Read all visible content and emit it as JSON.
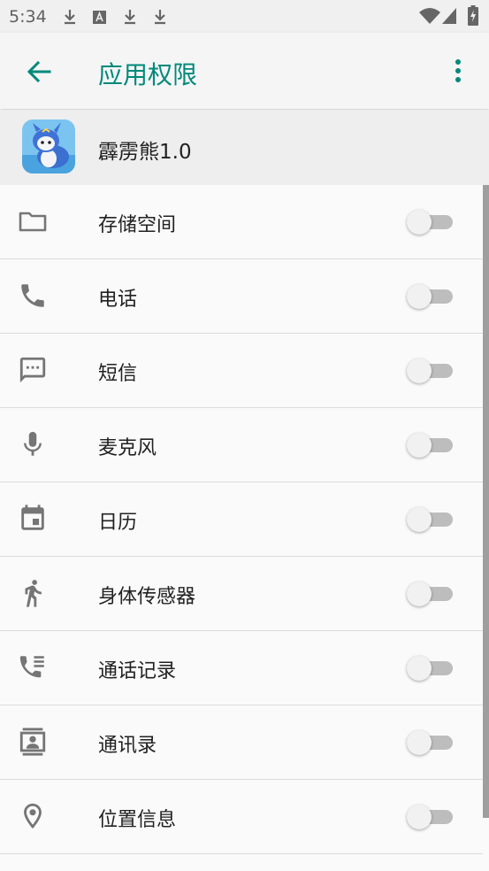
{
  "status_bar": {
    "time": "5:34",
    "icons": [
      "download-icon",
      "font-icon",
      "download-icon",
      "download-icon",
      "wifi-icon",
      "signal-icon",
      "battery-charging-icon"
    ]
  },
  "app_bar": {
    "title": "应用权限",
    "accent_color": "#00897b"
  },
  "app": {
    "name": "霹雳熊1.0"
  },
  "permissions": [
    {
      "label": "存储空间",
      "icon": "folder-icon",
      "enabled": false
    },
    {
      "label": "电话",
      "icon": "phone-icon",
      "enabled": false
    },
    {
      "label": "短信",
      "icon": "sms-icon",
      "enabled": false
    },
    {
      "label": "麦克风",
      "icon": "microphone-icon",
      "enabled": false
    },
    {
      "label": "日历",
      "icon": "calendar-icon",
      "enabled": false
    },
    {
      "label": "身体传感器",
      "icon": "running-icon",
      "enabled": false
    },
    {
      "label": "通话记录",
      "icon": "call-log-icon",
      "enabled": false
    },
    {
      "label": "通讯录",
      "icon": "contacts-icon",
      "enabled": false
    },
    {
      "label": "位置信息",
      "icon": "location-icon",
      "enabled": false
    }
  ]
}
